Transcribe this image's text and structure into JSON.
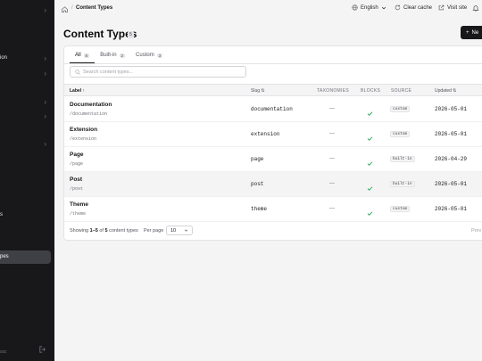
{
  "sidebar": {
    "items": [
      {
        "label": "ion"
      },
      {
        "label": "s"
      },
      {
        "label": "pes"
      }
    ],
    "footer": "ssc"
  },
  "topbar": {
    "breadcrumb_current": "Content Types",
    "language": "English",
    "clear_cache": "Clear cache",
    "visit_site": "Visit site"
  },
  "header": {
    "title": "Content Types",
    "count": "5",
    "new_button": "Ne"
  },
  "tabs": [
    {
      "label": "All",
      "count": "5"
    },
    {
      "label": "Built-in",
      "count": "2"
    },
    {
      "label": "Custom",
      "count": "3"
    }
  ],
  "search": {
    "placeholder": "Search content types..."
  },
  "columns": {
    "label": "Label",
    "slug": "Slug",
    "taxonomies": "TAXONOMIES",
    "blocks": "BLOCKS",
    "source": "SOURCE",
    "updated": "Updated"
  },
  "rows": [
    {
      "name": "Documentation",
      "path": "/documentation",
      "slug": "documentation",
      "taxonomies": "—",
      "source": "custom",
      "updated": "2026-05-01"
    },
    {
      "name": "Extension",
      "path": "/extension",
      "slug": "extension",
      "taxonomies": "—",
      "source": "custom",
      "updated": "2026-05-01"
    },
    {
      "name": "Page",
      "path": "/page",
      "slug": "page",
      "taxonomies": "—",
      "source": "built-in",
      "updated": "2026-04-29"
    },
    {
      "name": "Post",
      "path": "/post",
      "slug": "post",
      "taxonomies": "—",
      "source": "built-in",
      "updated": "2026-05-01"
    },
    {
      "name": "Theme",
      "path": "/theme",
      "slug": "theme",
      "taxonomies": "—",
      "source": "custom",
      "updated": "2026-05-01"
    }
  ],
  "footer": {
    "showing_prefix": "Showing",
    "range": "1–5",
    "of": "of",
    "total": "5",
    "suffix": "content types",
    "per_page_label": "Per page",
    "per_page_value": "10",
    "prev": "Prev"
  },
  "colors": {
    "sidebar_bg": "#18181b",
    "check": "#16a34a",
    "primary": "#18181b"
  }
}
